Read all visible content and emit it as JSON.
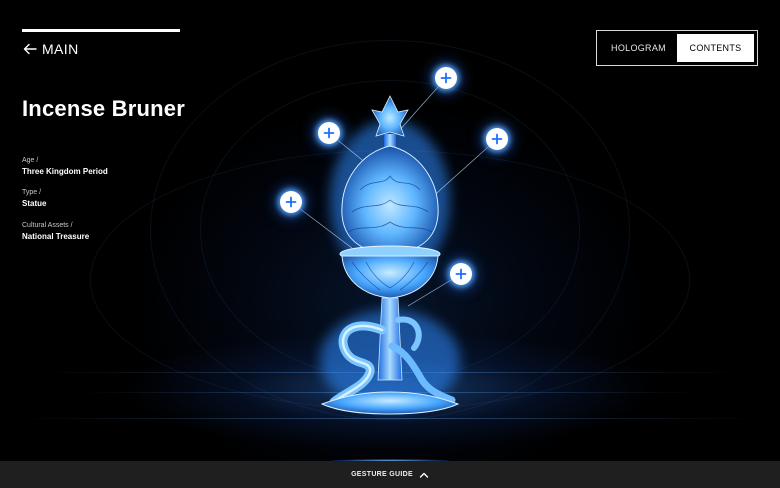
{
  "navigation": {
    "back_label": "MAIN",
    "back_icon": "arrow-left-icon"
  },
  "artifact": {
    "title": "Incense Bruner",
    "details": [
      {
        "key": "Age /",
        "value": "Three Kingdom Period"
      },
      {
        "key": "Type /",
        "value": "Statue"
      },
      {
        "key": "Cultural Assets /",
        "value": "National Treasure"
      }
    ]
  },
  "view_toggle": {
    "options": [
      {
        "label": "HOLOGRAM",
        "active": false
      },
      {
        "label": "CONTENTS",
        "active": true
      }
    ]
  },
  "hotspots": {
    "count": 5,
    "icon": "plus-icon"
  },
  "bottom_bar": {
    "label": "GESTURE GUIDE",
    "icon": "chevron-up-icon"
  },
  "colors": {
    "background": "#000000",
    "glow": "#3c96ff",
    "hologram": "#6cc4ff",
    "bar": "#1f1f1f",
    "accent_white": "#ffffff"
  }
}
